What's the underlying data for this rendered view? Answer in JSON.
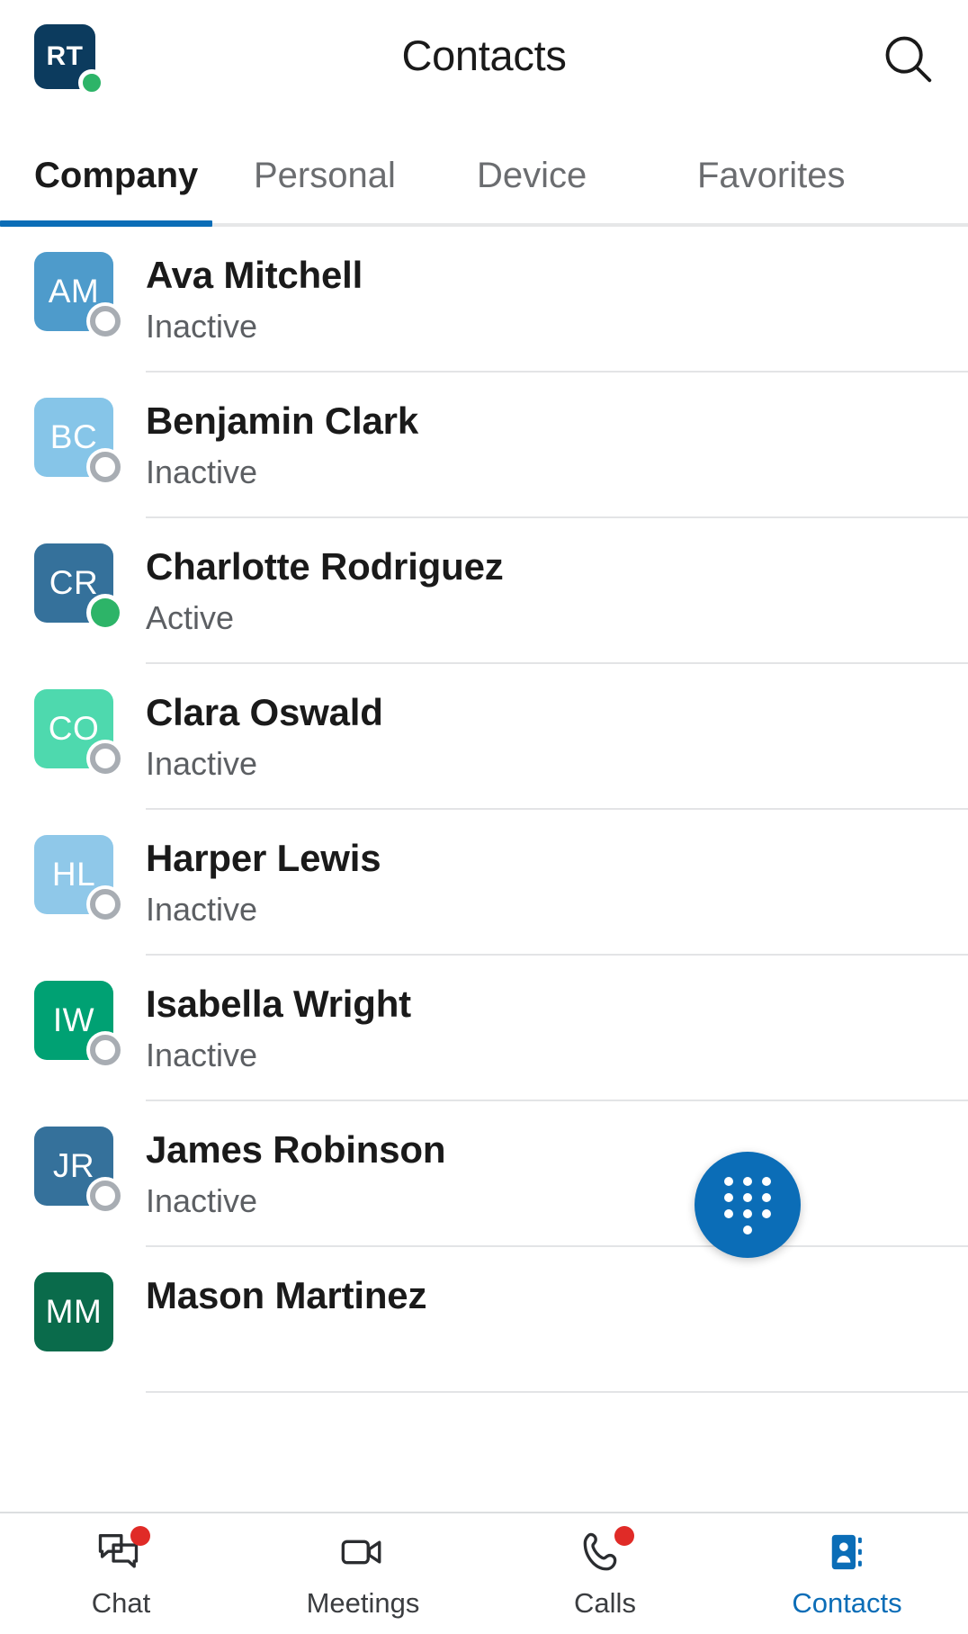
{
  "header": {
    "self_avatar_initials": "RT",
    "self_avatar_color": "#0C3B5E",
    "self_presence": "available",
    "self_presence_color": "#2DB468",
    "title": "Contacts",
    "search_icon": "search-icon"
  },
  "tabs": {
    "items": [
      {
        "label": "Company",
        "active": true
      },
      {
        "label": "Personal",
        "active": false
      },
      {
        "label": "Device",
        "active": false
      },
      {
        "label": "Favorites",
        "active": false
      }
    ],
    "active_index": 0,
    "indicator_color": "#0B6DB7"
  },
  "contacts": [
    {
      "initials": "AM",
      "name": "Ava Mitchell",
      "status": "Inactive",
      "avatar_color": "#4E9BCB",
      "presence": "inactive"
    },
    {
      "initials": "BC",
      "name": "Benjamin Clark",
      "status": "Inactive",
      "avatar_color": "#86C5E8",
      "presence": "inactive"
    },
    {
      "initials": "CR",
      "name": "Charlotte Rodriguez",
      "status": "Active",
      "avatar_color": "#35719B",
      "presence": "active"
    },
    {
      "initials": "CO",
      "name": "Clara Oswald",
      "status": "Inactive",
      "avatar_color": "#4ED9AE",
      "presence": "inactive"
    },
    {
      "initials": "HL",
      "name": "Harper Lewis",
      "status": "Inactive",
      "avatar_color": "#8FC8E9",
      "presence": "inactive"
    },
    {
      "initials": "IW",
      "name": "Isabella Wright",
      "status": "Inactive",
      "avatar_color": "#00A173",
      "presence": "inactive"
    },
    {
      "initials": "JR",
      "name": "James Robinson",
      "status": "Inactive",
      "avatar_color": "#35719B",
      "presence": "inactive"
    },
    {
      "initials": "MM",
      "name": "Mason Martinez",
      "status": "",
      "avatar_color": "#0A6B4B",
      "presence": "none"
    }
  ],
  "fab": {
    "icon": "dialpad-icon",
    "color": "#0B6DB7",
    "label": "Dialpad"
  },
  "bottom_nav": {
    "items": [
      {
        "label": "Chat",
        "icon": "chat-bubbles-icon",
        "badge": true,
        "active": false
      },
      {
        "label": "Meetings",
        "icon": "video-camera-icon",
        "badge": false,
        "active": false
      },
      {
        "label": "Calls",
        "icon": "phone-handset-icon",
        "badge": true,
        "active": false
      },
      {
        "label": "Contacts",
        "icon": "address-book-icon",
        "badge": false,
        "active": true
      }
    ],
    "active_color": "#0B6DB7",
    "badge_color": "#E02B27"
  }
}
